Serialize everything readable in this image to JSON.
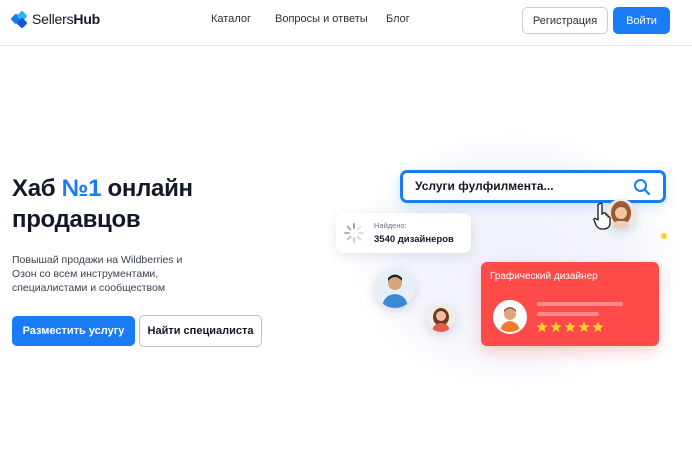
{
  "header": {
    "logo": {
      "text_a": "Sellers",
      "text_b": "Hub"
    },
    "nav": [
      "Каталог",
      "Вопросы и ответы",
      "Блог"
    ],
    "register_label": "Регистрация",
    "login_label": "Войти"
  },
  "hero": {
    "title_part1": "Хаб ",
    "title_accent": "№1",
    "title_part2": " онлайн продавцов",
    "subtitle": "Повышай продажи на Wildberries и Озон со всем инструментами, специалистами и сообществом",
    "primary_button": "Разместить услугу",
    "secondary_button": "Найти специалиста"
  },
  "illustration": {
    "search_text": "Услуги фулфилмента...",
    "found_label": "Найдено:",
    "found_count": "3540 дизайнеров",
    "card_title": "Графический дизайнер",
    "rating_stars": 5,
    "icons": [
      "search-icon",
      "spinner-icon",
      "cursor-hand-icon",
      "star-icon"
    ],
    "colors": {
      "accent": "#1a7cf5",
      "card": "#ff4a4a",
      "star": "#ffd22b"
    }
  }
}
